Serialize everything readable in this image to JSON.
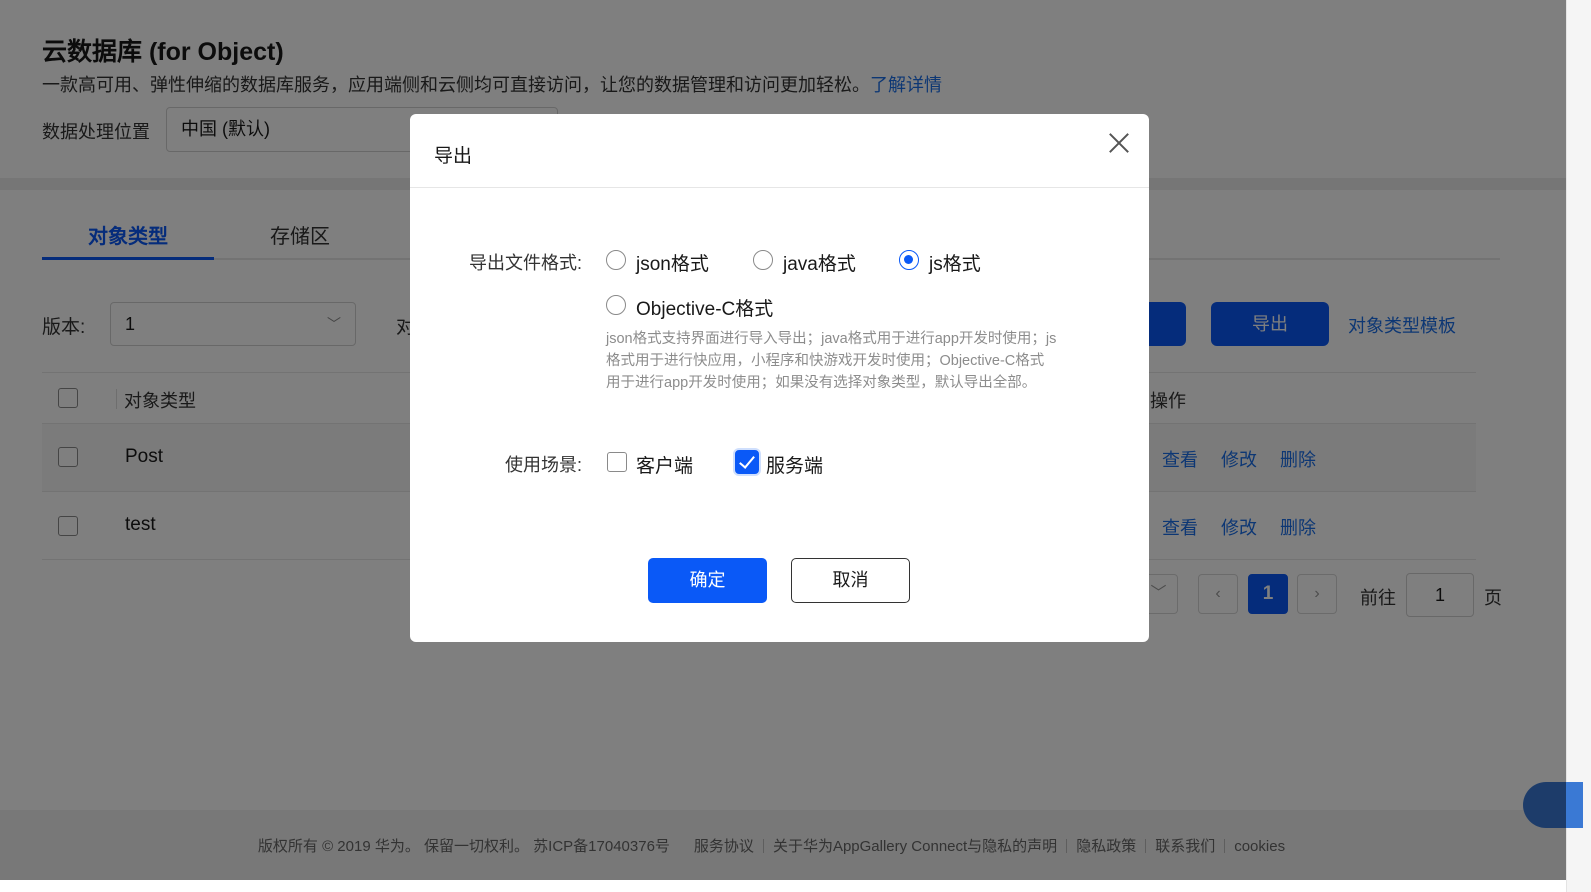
{
  "header": {
    "title": "云数据库 (for Object)",
    "description": "一款高可用、弹性伸缩的数据库服务，应用端侧和云侧均可直接访问，让您的数据管理和访问更加轻松。",
    "learn_more": "了解详情",
    "region_label": "数据处理位置",
    "region_value": "中国 (默认)"
  },
  "tabs": [
    {
      "label": "对象类型",
      "active": true
    },
    {
      "label": "存储区",
      "active": false
    }
  ],
  "toolbar": {
    "version_label": "版本:",
    "version_value": "1",
    "object_label_partial": "对",
    "export_label": "导出",
    "template_link": "对象类型模板"
  },
  "table": {
    "headers": {
      "name": "对象类型",
      "ops": "操作"
    },
    "rows": [
      {
        "name": "Post",
        "view": "查看",
        "edit": "修改",
        "delete": "删除"
      },
      {
        "name": "test",
        "view": "查看",
        "edit": "修改",
        "delete": "删除"
      }
    ]
  },
  "pagination": {
    "current_page": "1",
    "goto_label": "前往",
    "goto_value": "1",
    "page_unit": "页"
  },
  "footer": {
    "copyright": "版权所有 © 2019 华为。 保留一切权利。 苏ICP备17040376号",
    "links": [
      "服务协议",
      "关于华为AppGallery Connect与隐私的声明",
      "隐私政策",
      "联系我们",
      "cookies"
    ]
  },
  "dialog": {
    "title": "导出",
    "format_label": "导出文件格式:",
    "formats": [
      {
        "label": "json格式",
        "selected": false
      },
      {
        "label": "java格式",
        "selected": false
      },
      {
        "label": "js格式",
        "selected": true
      },
      {
        "label": "Objective-C格式",
        "selected": false
      }
    ],
    "hint": "json格式支持界面进行导入导出；java格式用于进行app开发时使用；js格式用于进行快应用，小程序和快游戏开发时使用；Objective-C格式用于进行app开发时使用；如果没有选择对象类型，默认导出全部。",
    "scene_label": "使用场景:",
    "scenes": [
      {
        "label": "客户端",
        "checked": false
      },
      {
        "label": "服务端",
        "checked": true
      }
    ],
    "confirm_label": "确定",
    "cancel_label": "取消"
  },
  "colors": {
    "brand": "#0a59f7",
    "link": "#1a6ee8",
    "mask": "rgba(0,0,0,0.5)"
  }
}
